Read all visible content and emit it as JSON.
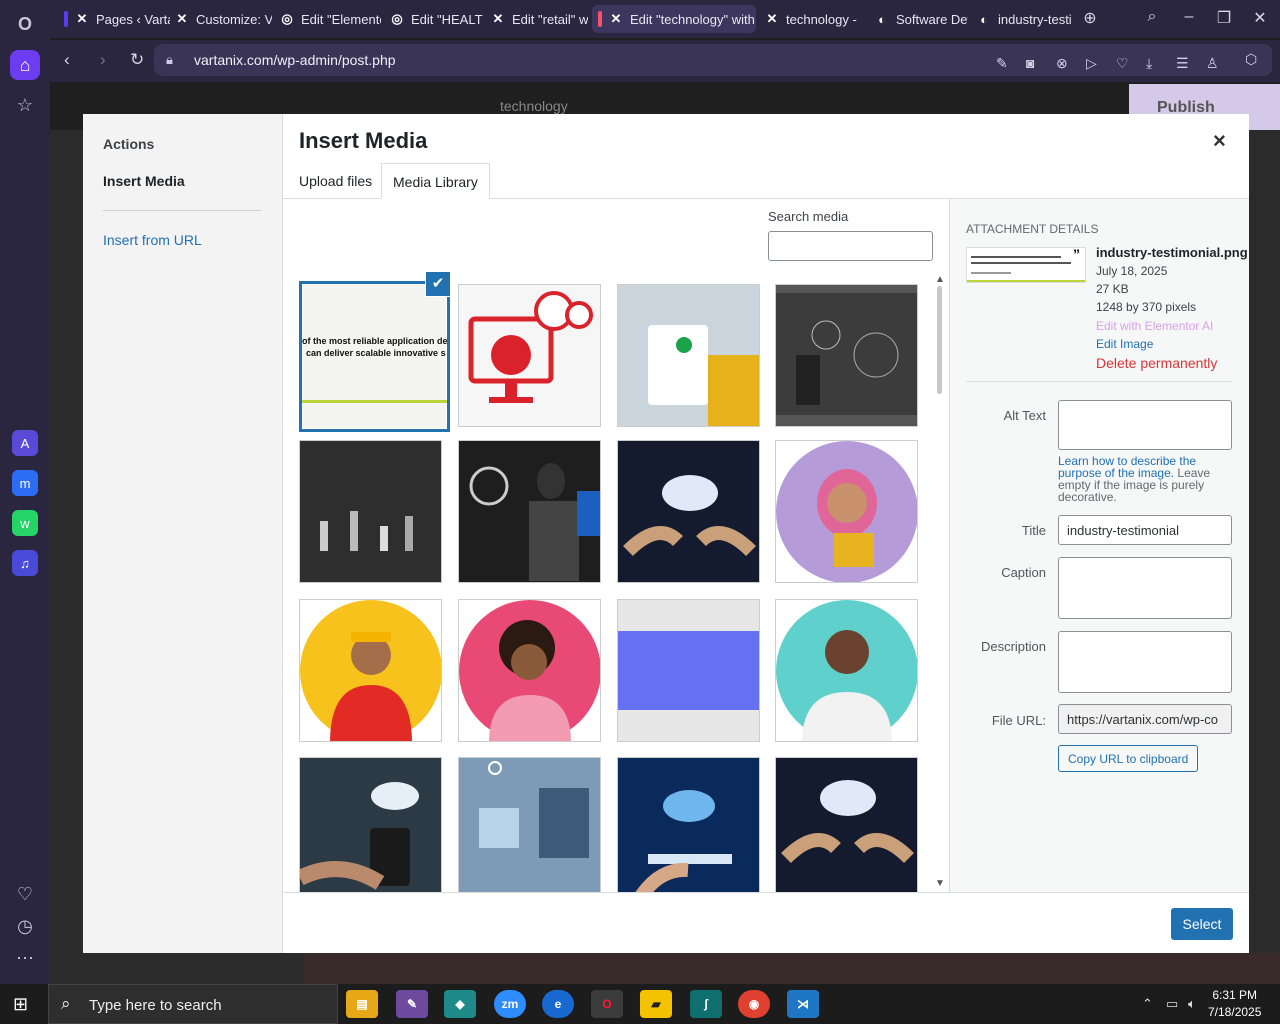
{
  "browser": {
    "tabs": [
      {
        "label": "Pages ‹ Vartan",
        "color": "#5b3cf0"
      },
      {
        "label": "Customize: Va",
        "color": ""
      },
      {
        "label": "Edit \"Elemento",
        "color": ""
      },
      {
        "label": "Edit \"HEALTH",
        "color": ""
      },
      {
        "label": "Edit \"retail\" w",
        "color": ""
      },
      {
        "label": "Edit \"technology\" with",
        "color": "#ff4f6b"
      },
      {
        "label": "technology -",
        "color": ""
      },
      {
        "label": "Software Dev",
        "color": ""
      },
      {
        "label": "industry-testi",
        "color": ""
      }
    ],
    "url": "vartanix.com/wp-admin/post.php"
  },
  "editor": {
    "doc_title": "technology",
    "publish_label": "Publish"
  },
  "modal": {
    "sidebar_heading": "Actions",
    "sidebar_items": [
      "Insert Media",
      "Insert from URL"
    ],
    "title": "Insert Media",
    "close": "×",
    "tabs": [
      "Upload files",
      "Media Library"
    ],
    "search_label": "Search media",
    "select_label": "Select",
    "thumb_text": [
      "of the most reliable application de",
      "can deliver scalable innovative s"
    ]
  },
  "details": {
    "heading": "ATTACHMENT DETAILS",
    "filename": "industry-testimonial.png",
    "date": "July 18, 2025",
    "size": "27 KB",
    "dimensions": "1248 by 370 pixels",
    "edit_ai": "Edit with Elementor AI",
    "edit_image": "Edit Image",
    "delete": "Delete permanently",
    "alt_label": "Alt Text",
    "help_link": "Learn how to describe the purpose of the image.",
    "help_text": " Leave empty if the image is purely decorative.",
    "title_label": "Title",
    "title_value": "industry-testimonial",
    "caption_label": "Caption",
    "description_label": "Description",
    "fileurl_label": "File URL:",
    "fileurl_value": "https://vartanix.com/wp-co",
    "copy_label": "Copy URL to clipboard"
  },
  "taskbar": {
    "search": "Type here to search",
    "time": "6:31 PM",
    "date": "7/18/2025"
  }
}
